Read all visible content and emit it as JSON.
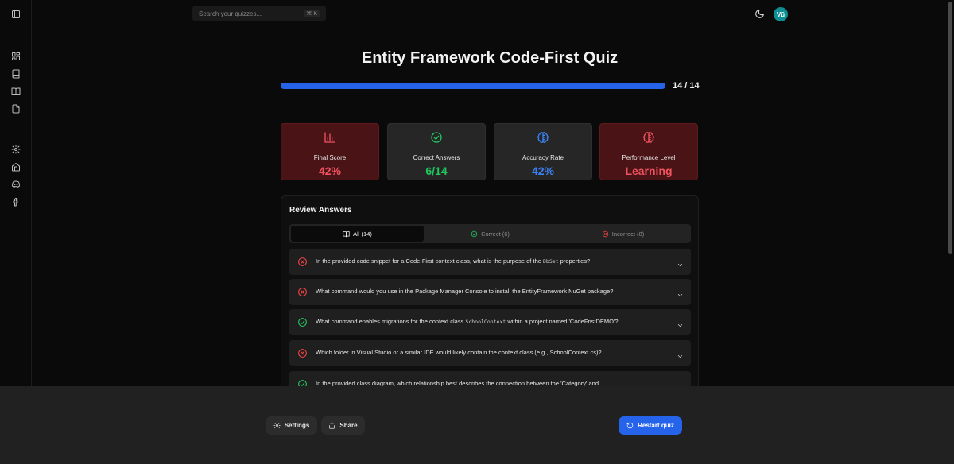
{
  "search": {
    "placeholder": "Search your quizzes...",
    "shortcut": "⌘ K"
  },
  "user": {
    "initials": "Vũ"
  },
  "quiz": {
    "title": "Entity Framework Code-First Quiz",
    "progress_text": "14 / 14",
    "progress_fraction": 1.0
  },
  "stats": [
    {
      "label": "Final Score",
      "value": "42%",
      "icon": "bar-chart-icon",
      "value_color": "#f0525e"
    },
    {
      "label": "Correct Answers",
      "value": "6/14",
      "icon": "check-circle-icon",
      "value_color": "#22c55e"
    },
    {
      "label": "Accuracy Rate",
      "value": "42%",
      "icon": "brain-icon",
      "value_color": "#3b82f6"
    },
    {
      "label": "Performance Level",
      "value": "Learning",
      "icon": "brain-icon",
      "value_color": "#f0525e"
    }
  ],
  "review": {
    "title": "Review Answers",
    "tabs": {
      "all": "All (14)",
      "correct": "Correct (6)",
      "incorrect": "Incorrect (8)"
    },
    "questions": [
      {
        "status": "incorrect",
        "pre": "In the provided code snippet for a Code-First context class, what is the purpose of the ",
        "code": "DbSet",
        "post": " properties?"
      },
      {
        "status": "incorrect",
        "pre": "What command would you use in the Package Manager Console to install the EntityFramework NuGet package?",
        "code": "",
        "post": ""
      },
      {
        "status": "correct",
        "pre": "What command enables migrations for the context class ",
        "code": "SchoolContext",
        "post": " within a project named 'CodeFristDEMO'?"
      },
      {
        "status": "incorrect",
        "pre": "Which folder in Visual Studio or a similar IDE would likely contain the context class (e.g., SchoolContext.cs)?",
        "code": "",
        "post": ""
      },
      {
        "status": "correct",
        "pre": "In the provided class diagram, which relationship best describes the connection between the 'Category' and",
        "code": "",
        "post": ""
      }
    ]
  },
  "actions": {
    "settings": "Settings",
    "share": "Share",
    "restart": "Restart quiz"
  },
  "colors": {
    "accent": "#2563eb",
    "correct": "#22c55e",
    "incorrect": "#ef4444"
  }
}
